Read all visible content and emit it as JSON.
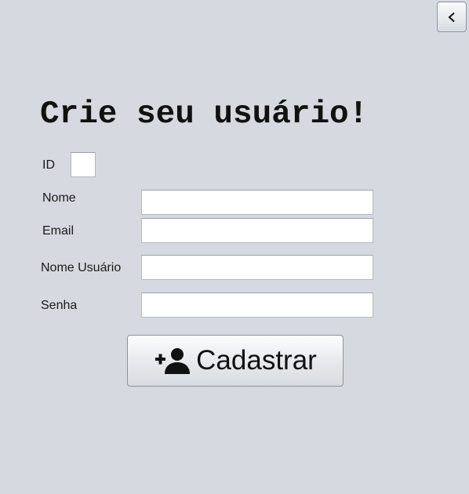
{
  "header": {
    "back_icon": "chevron-left-icon"
  },
  "form": {
    "title": "Crie seu usuário!",
    "id_label": "ID",
    "id_value": "",
    "name_label": "Nome",
    "name_value": "",
    "email_label": "Email",
    "email_value": "",
    "username_label": "Nome Usuário",
    "username_value": "",
    "password_label": "Senha",
    "password_value": ""
  },
  "actions": {
    "register_label": "Cadastrar",
    "register_icon": "user-plus-icon"
  }
}
